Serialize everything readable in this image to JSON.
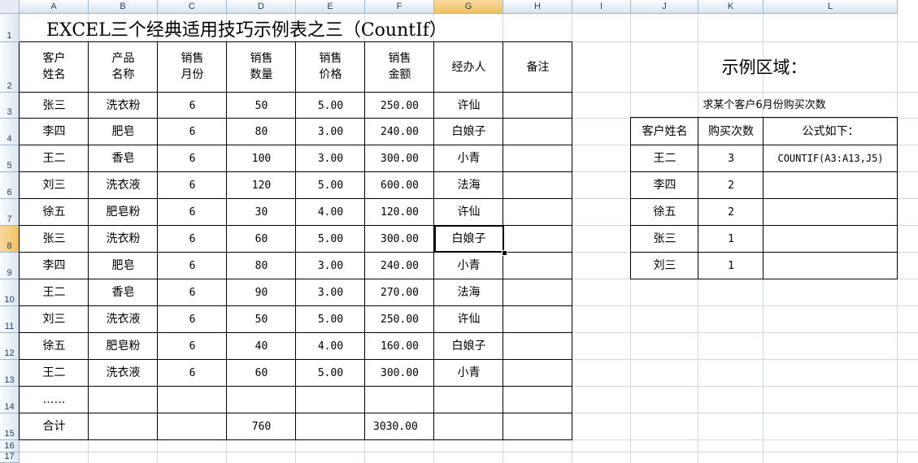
{
  "columns": [
    "A",
    "B",
    "C",
    "D",
    "E",
    "F",
    "G",
    "H",
    "I",
    "J",
    "K",
    "L"
  ],
  "rows": [
    "1",
    "2",
    "3",
    "4",
    "5",
    "6",
    "7",
    "8",
    "9",
    "10",
    "11",
    "12",
    "13",
    "14",
    "15",
    "16",
    "17"
  ],
  "selected_column": "G",
  "selected_row": "8",
  "title": "EXCEL三个经典适用技巧示例表之三（CountIf）",
  "main_table": {
    "headers": [
      {
        "line1": "客户",
        "line2": "姓名"
      },
      {
        "line1": "产品",
        "line2": "名称"
      },
      {
        "line1": "销售",
        "line2": "月份"
      },
      {
        "line1": "销售",
        "line2": "数量"
      },
      {
        "line1": "销售",
        "line2": "价格"
      },
      {
        "line1": "销售",
        "line2": "金额"
      },
      {
        "line1": "经办人",
        "line2": ""
      },
      {
        "line1": "备注",
        "line2": ""
      }
    ],
    "rows": [
      [
        "张三",
        "洗衣粉",
        "6",
        "50",
        "5.00",
        "250.00",
        "许仙",
        ""
      ],
      [
        "李四",
        "肥皂",
        "6",
        "80",
        "3.00",
        "240.00",
        "白娘子",
        ""
      ],
      [
        "王二",
        "香皂",
        "6",
        "100",
        "3.00",
        "300.00",
        "小青",
        ""
      ],
      [
        "刘三",
        "洗衣液",
        "6",
        "120",
        "5.00",
        "600.00",
        "法海",
        ""
      ],
      [
        "徐五",
        "肥皂粉",
        "6",
        "30",
        "4.00",
        "120.00",
        "许仙",
        ""
      ],
      [
        "张三",
        "洗衣粉",
        "6",
        "60",
        "5.00",
        "300.00",
        "白娘子",
        ""
      ],
      [
        "李四",
        "肥皂",
        "6",
        "80",
        "3.00",
        "240.00",
        "小青",
        ""
      ],
      [
        "王二",
        "香皂",
        "6",
        "90",
        "3.00",
        "270.00",
        "法海",
        ""
      ],
      [
        "刘三",
        "洗衣液",
        "6",
        "50",
        "5.00",
        "250.00",
        "许仙",
        ""
      ],
      [
        "徐五",
        "肥皂粉",
        "6",
        "40",
        "4.00",
        "160.00",
        "白娘子",
        ""
      ],
      [
        "王二",
        "洗衣液",
        "6",
        "60",
        "5.00",
        "300.00",
        "小青",
        ""
      ],
      [
        "……",
        "",
        "",
        "",
        "",
        "",
        "",
        ""
      ],
      [
        "合计",
        "",
        "",
        "760",
        "",
        "3030.00",
        "",
        ""
      ]
    ]
  },
  "example": {
    "heading": "示例区域：",
    "subheading": "求某个客户6月份购买次数",
    "headers": [
      "客户姓名",
      "购买次数",
      "公式如下："
    ],
    "rows": [
      [
        "王二",
        "3",
        "COUNTIF(A3:A13,J5)"
      ],
      [
        "李四",
        "2",
        ""
      ],
      [
        "徐五",
        "2",
        ""
      ],
      [
        "张三",
        "1",
        ""
      ],
      [
        "刘三",
        "1",
        ""
      ]
    ]
  }
}
